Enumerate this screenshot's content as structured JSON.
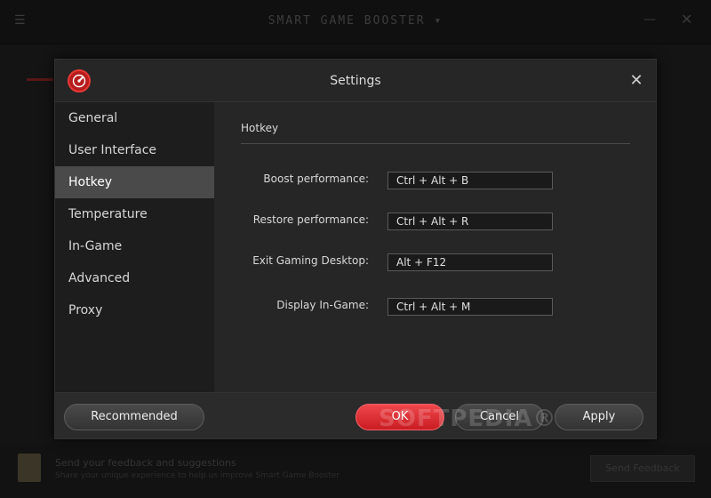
{
  "background": {
    "title": "SMART GAME BOOSTER ▾",
    "menu_icon": "menu-icon",
    "minimize_glyph": "—",
    "close_glyph": "✕",
    "footer": {
      "title": "Send your feedback and suggestions",
      "subtitle": "Share your unique experience to help us improve Smart Game Booster",
      "button": "Send Feedback"
    }
  },
  "dialog": {
    "title": "Settings",
    "logo_icon": "speedometer-logo-icon",
    "close_glyph": "✕",
    "nav": [
      {
        "label": "General",
        "active": false
      },
      {
        "label": "User Interface",
        "active": false
      },
      {
        "label": "Hotkey",
        "active": true
      },
      {
        "label": "Temperature",
        "active": false
      },
      {
        "label": "In-Game",
        "active": false
      },
      {
        "label": "Advanced",
        "active": false
      },
      {
        "label": "Proxy",
        "active": false
      }
    ],
    "section_title": "Hotkey",
    "hotkeys": [
      {
        "label": "Boost performance:",
        "value": "Ctrl + Alt + B"
      },
      {
        "label": "Restore performance:",
        "value": "Ctrl + Alt + R"
      },
      {
        "label": "Exit Gaming Desktop:",
        "value": "Alt + F12"
      },
      {
        "label": "Display In-Game:",
        "value": "Ctrl + Alt + M"
      }
    ],
    "buttons": {
      "recommended": "Recommended",
      "ok": "OK",
      "cancel": "Cancel",
      "apply": "Apply"
    }
  },
  "watermark": "SOFTPEDIA®",
  "colors": {
    "accent": "#e53935",
    "active_nav": "#4a4a4a",
    "dialog_bg": "#222222"
  }
}
